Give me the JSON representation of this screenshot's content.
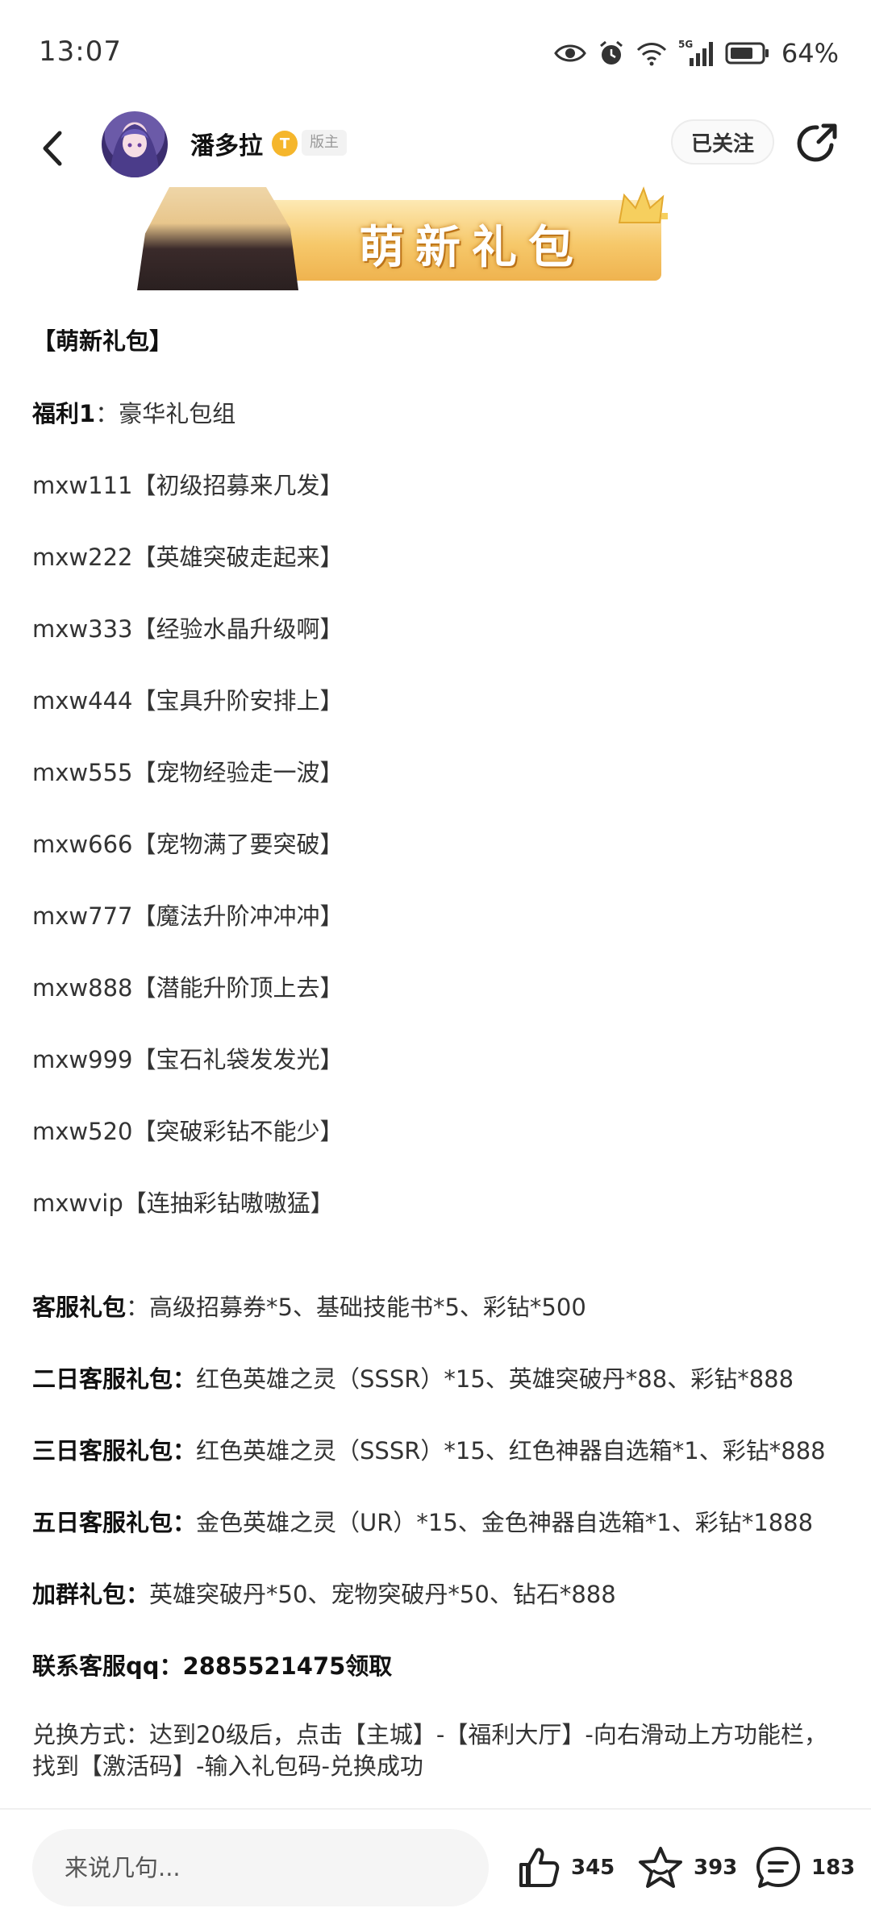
{
  "status_bar": {
    "time": "13:07",
    "battery": "64%",
    "network": "5G"
  },
  "header": {
    "username": "潘多拉",
    "level_badge": "T",
    "role_badge": "版主",
    "follow_label": "已关注"
  },
  "banner": {
    "text": "萌新礼包"
  },
  "article": {
    "title": "【萌新礼包】",
    "welfare1": {
      "label": "福利1",
      "sep": "：",
      "text": "豪华礼包组"
    },
    "codes": [
      "mxw111【初级招募来几发】",
      "mxw222【英雄突破走起来】",
      "mxw333【经验水晶升级啊】",
      "mxw444【宝具升阶安排上】",
      "mxw555【宠物经验走一波】",
      "mxw666【宠物满了要突破】",
      "mxw777【魔法升阶冲冲冲】",
      "mxw888【潜能升阶顶上去】",
      "mxw999【宝石礼袋发发光】",
      "mxw520【突破彩钻不能少】",
      "mxwvip【连抽彩钻嗷嗷猛】"
    ],
    "gifts": [
      {
        "label": "客服礼包",
        "sep": "：",
        "text": "高级招募券*5、基础技能书*5、彩钻*500"
      },
      {
        "label": "二日客服礼包：",
        "sep": "",
        "text": "红色英雄之灵（SSSR）*15、英雄突破丹*88、彩钻*888"
      },
      {
        "label": "三日客服礼包：",
        "sep": "",
        "text": "红色英雄之灵（SSSR）*15、红色神器自选箱*1、彩钻*888"
      },
      {
        "label": "五日客服礼包：",
        "sep": "",
        "text": "金色英雄之灵（UR）*15、金色神器自选箱*1、彩钻*1888"
      },
      {
        "label": "加群礼包：",
        "sep": "",
        "text": "英雄突破丹*50、宠物突破丹*50、钻石*888"
      }
    ],
    "contact": "联系客服qq：2885521475领取",
    "redeem_line1": "兑换方式：达到20级后，点击【主城】-【福利大厅】-向右滑动上方功能栏，",
    "redeem_line2": "找到【激活码】-输入礼包码-兑换成功"
  },
  "bottom_bar": {
    "comment_placeholder": "来说几句...",
    "likes": "345",
    "favorites": "393",
    "comments": "183"
  },
  "colors": {
    "accent_gold": "#f5b62c",
    "text_main": "#333333",
    "bg": "#ffffff"
  },
  "icons": [
    "back-arrow-icon",
    "share-icon",
    "eye-icon",
    "alarm-icon",
    "wifi-icon",
    "signal-icon",
    "battery-icon",
    "thumb-up-icon",
    "star-icon",
    "comment-icon"
  ]
}
